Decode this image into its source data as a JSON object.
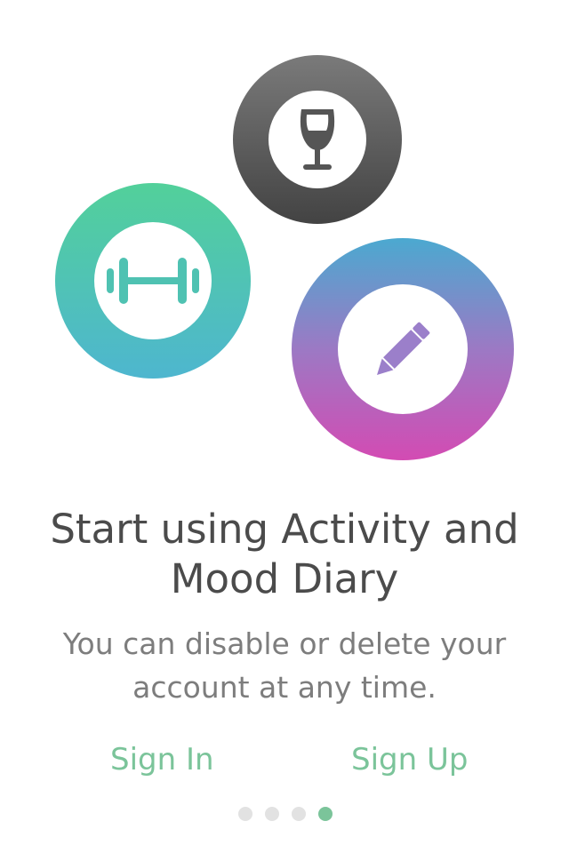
{
  "onboarding": {
    "icons": {
      "wine": "wine-glass-icon",
      "fitness": "dumbbell-icon",
      "diary": "pencil-icon"
    },
    "colors": {
      "wine_gradient": [
        "#7a7a7a",
        "#434343"
      ],
      "fitness_gradient": [
        "#52d09a",
        "#4eb6cf"
      ],
      "diary_gradient": [
        "#4ba9d0",
        "#9c79c4",
        "#d34bb3"
      ],
      "accent": "#7bc49a"
    },
    "title_line1": "Start using Activity and",
    "title_line2": "Mood Diary",
    "subtitle_line1": "You can disable or delete your",
    "subtitle_line2": "account at any time.",
    "sign_in_label": "Sign In",
    "sign_up_label": "Sign Up",
    "pager": {
      "page_count": 4,
      "current_page": 4
    }
  }
}
